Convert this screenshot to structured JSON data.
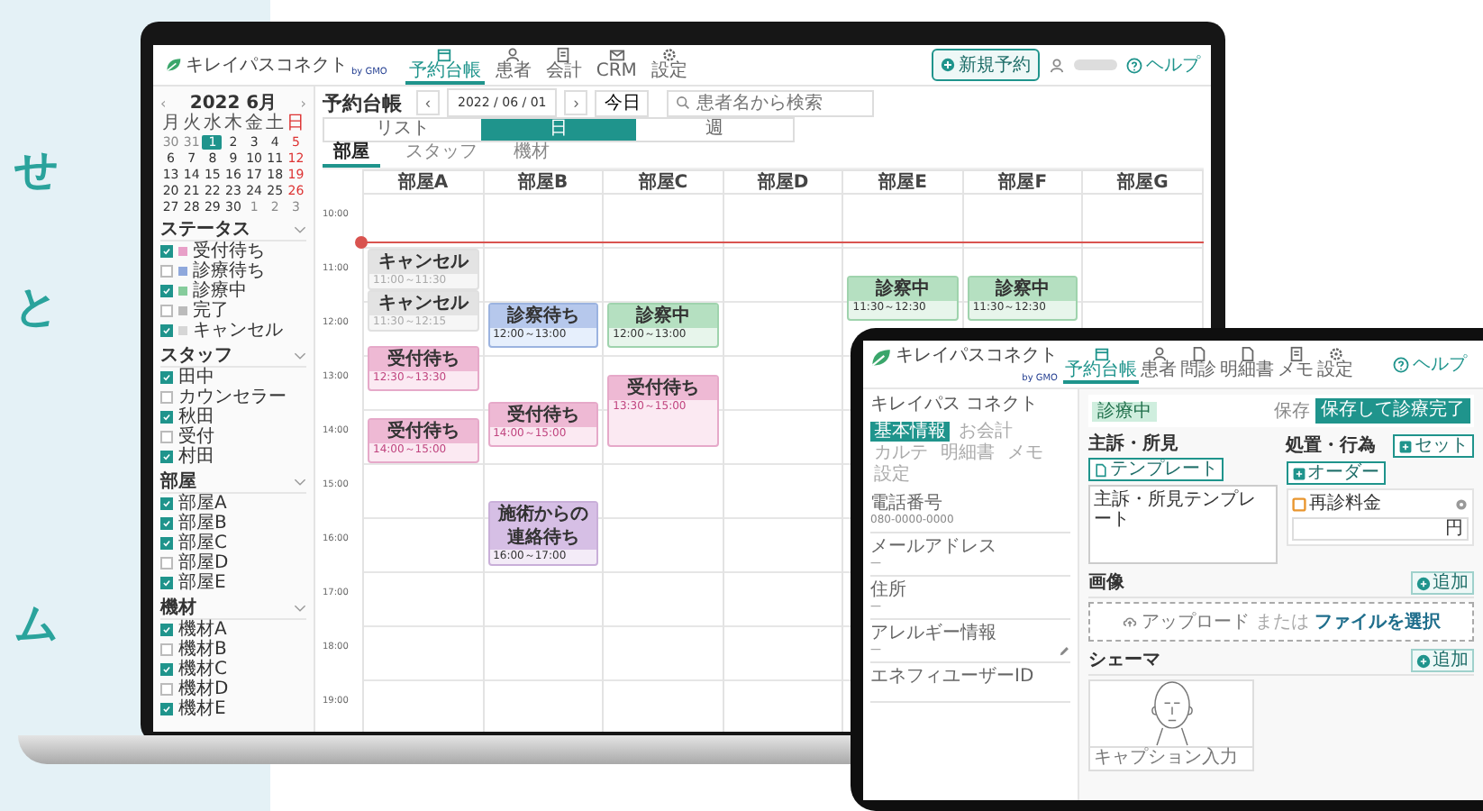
{
  "promo": {
    "chars": [
      "せ",
      "と",
      "ム"
    ]
  },
  "laptop": {
    "logo": {
      "name": "キレイパスコネクト",
      "by": "by GMO"
    },
    "nav": [
      {
        "label": "予約台帳",
        "selected": true
      },
      {
        "label": "患者",
        "selected": false
      },
      {
        "label": "会計",
        "selected": false
      },
      {
        "label": "CRM",
        "selected": false
      },
      {
        "label": "設定",
        "selected": false
      }
    ],
    "new_button": "新規予約",
    "help": "ヘルプ",
    "mini_calendar": {
      "month": "2022 6月",
      "prev": "‹",
      "next": "›",
      "weekdays": [
        "月",
        "火",
        "水",
        "木",
        "金",
        "土",
        "日"
      ],
      "weeks": [
        [
          {
            "day": "30",
            "outside": true,
            "selected": false
          },
          {
            "day": "31",
            "outside": true,
            "selected": false
          },
          {
            "day": "1",
            "outside": false,
            "selected": true
          },
          {
            "day": "2",
            "outside": false,
            "selected": false
          },
          {
            "day": "3",
            "outside": false,
            "selected": false
          },
          {
            "day": "4",
            "outside": false,
            "selected": false
          },
          {
            "day": "5",
            "outside": false,
            "selected": false
          }
        ],
        [
          {
            "day": "6",
            "outside": false,
            "selected": false
          },
          {
            "day": "7",
            "outside": false,
            "selected": false
          },
          {
            "day": "8",
            "outside": false,
            "selected": false
          },
          {
            "day": "9",
            "outside": false,
            "selected": false
          },
          {
            "day": "10",
            "outside": false,
            "selected": false
          },
          {
            "day": "11",
            "outside": false,
            "selected": false
          },
          {
            "day": "12",
            "outside": false,
            "selected": false
          }
        ],
        [
          {
            "day": "13",
            "outside": false,
            "selected": false
          },
          {
            "day": "14",
            "outside": false,
            "selected": false
          },
          {
            "day": "15",
            "outside": false,
            "selected": false
          },
          {
            "day": "16",
            "outside": false,
            "selected": false
          },
          {
            "day": "17",
            "outside": false,
            "selected": false
          },
          {
            "day": "18",
            "outside": false,
            "selected": false
          },
          {
            "day": "19",
            "outside": false,
            "selected": false
          }
        ],
        [
          {
            "day": "20",
            "outside": false,
            "selected": false
          },
          {
            "day": "21",
            "outside": false,
            "selected": false
          },
          {
            "day": "22",
            "outside": false,
            "selected": false
          },
          {
            "day": "23",
            "outside": false,
            "selected": false
          },
          {
            "day": "24",
            "outside": false,
            "selected": false
          },
          {
            "day": "25",
            "outside": false,
            "selected": false
          },
          {
            "day": "26",
            "outside": false,
            "selected": false
          }
        ],
        [
          {
            "day": "27",
            "outside": false,
            "selected": false
          },
          {
            "day": "28",
            "outside": false,
            "selected": false
          },
          {
            "day": "29",
            "outside": false,
            "selected": false
          },
          {
            "day": "30",
            "outside": false,
            "selected": false
          },
          {
            "day": "1",
            "outside": true,
            "selected": false
          },
          {
            "day": "2",
            "outside": true,
            "selected": false
          },
          {
            "day": "3",
            "outside": true,
            "selected": false
          }
        ]
      ]
    },
    "filters": [
      {
        "title": "ステータス",
        "expanded": true,
        "items": [
          {
            "label": "受付待ち",
            "checked": true,
            "color": "#e8a0c8"
          },
          {
            "label": "診療待ち",
            "checked": false,
            "color": "#8fa8dc"
          },
          {
            "label": "診療中",
            "checked": true,
            "color": "#86cc9c"
          },
          {
            "label": "完了",
            "checked": false,
            "color": "#bbbbbb"
          },
          {
            "label": "キャンセル",
            "checked": true,
            "color": "#d6d6d6"
          }
        ]
      },
      {
        "title": "スタッフ",
        "expanded": true,
        "items": [
          {
            "label": "田中",
            "checked": true
          },
          {
            "label": "カウンセラー",
            "checked": false
          },
          {
            "label": "秋田",
            "checked": true
          },
          {
            "label": "受付",
            "checked": false
          },
          {
            "label": "村田",
            "checked": true
          }
        ]
      },
      {
        "title": "部屋",
        "expanded": true,
        "items": [
          {
            "label": "部屋A",
            "checked": true
          },
          {
            "label": "部屋B",
            "checked": true
          },
          {
            "label": "部屋C",
            "checked": true
          },
          {
            "label": "部屋D",
            "checked": false
          },
          {
            "label": "部屋E",
            "checked": true
          }
        ]
      },
      {
        "title": "機材",
        "expanded": true,
        "items": [
          {
            "label": "機材A",
            "checked": true
          },
          {
            "label": "機材B",
            "checked": false
          },
          {
            "label": "機材C",
            "checked": true
          },
          {
            "label": "機材D",
            "checked": false
          },
          {
            "label": "機材E",
            "checked": true
          }
        ]
      }
    ],
    "toolbar": {
      "title": "予約台帳",
      "prev": "‹",
      "date": "2022 / 06 / 01",
      "next": "›",
      "today": "今日",
      "search_placeholder": "患者名から検索"
    },
    "views": [
      {
        "label": "リスト",
        "selected": false
      },
      {
        "label": "日",
        "selected": true
      },
      {
        "label": "週",
        "selected": false
      }
    ],
    "subtabs": [
      {
        "label": "部屋",
        "selected": true
      },
      {
        "label": "スタッフ",
        "selected": false
      },
      {
        "label": "機材",
        "selected": false
      }
    ],
    "times": [
      "10:00",
      "11:00",
      "12:00",
      "13:00",
      "14:00",
      "15:00",
      "16:00",
      "17:00",
      "18:00",
      "19:00"
    ],
    "rooms": [
      {
        "name": "部屋A",
        "events": [
          {
            "kind": "cancel",
            "status": "キャンセル",
            "time": "11:00～11:30"
          },
          {
            "kind": "cancel",
            "status": "キャンセル",
            "time": "11:30～12:15"
          },
          {
            "kind": "waiting",
            "status": "受付待ち",
            "time": "12:30～13:30"
          },
          {
            "kind": "waiting",
            "status": "受付待ち",
            "time": "14:00～15:00"
          }
        ]
      },
      {
        "name": "部屋B",
        "events": [
          {
            "kind": "exam_wait",
            "status": "診察待ち",
            "time": "12:00～13:00"
          },
          {
            "kind": "waiting",
            "status": "受付待ち",
            "time": "14:00～15:00"
          },
          {
            "kind": "contact",
            "status": "施術からの連絡待ち",
            "time": "16:00～17:00"
          }
        ]
      },
      {
        "name": "部屋C",
        "events": [
          {
            "kind": "in_exam",
            "status": "診察中",
            "time": "12:00～13:00"
          },
          {
            "kind": "waiting",
            "status": "受付待ち",
            "time": "13:30～15:00"
          }
        ]
      },
      {
        "name": "部屋D"
      },
      {
        "name": "部屋E",
        "events": [
          {
            "kind": "in_exam",
            "status": "診察中",
            "time": "11:30～12:30"
          }
        ]
      },
      {
        "name": "部屋F",
        "events": [
          {
            "kind": "in_exam",
            "status": "診察中",
            "time": "11:30～12:30"
          }
        ]
      },
      {
        "name": "部屋G"
      }
    ]
  },
  "tablet": {
    "logo": {
      "name": "キレイパスコネクト",
      "by": "by GMO"
    },
    "nav": [
      {
        "label": "予約台帳",
        "selected": true
      },
      {
        "label": "患者",
        "selected": false
      },
      {
        "label": "問診",
        "selected": false
      },
      {
        "label": "明細書",
        "selected": false
      },
      {
        "label": "メモ",
        "selected": false
      },
      {
        "label": "設定",
        "selected": false
      }
    ],
    "help": "ヘルプ",
    "patient": {
      "name": "キレイパス コネクト",
      "tabs": [
        {
          "label": "基本情報",
          "selected": true
        },
        {
          "label": "お会計",
          "selected": false
        },
        {
          "label": "カルテ",
          "selected": false
        },
        {
          "label": "明細書",
          "selected": false
        },
        {
          "label": "メモ",
          "selected": false
        },
        {
          "label": "設定",
          "selected": false
        }
      ],
      "fields": [
        {
          "label": "電話番号",
          "value": "080-0000-0000",
          "editable": false
        },
        {
          "label": "メールアドレス",
          "value": "—",
          "editable": false
        },
        {
          "label": "住所",
          "value": "—",
          "editable": false
        },
        {
          "label": "アレルギー情報",
          "value": "—",
          "editable": true
        },
        {
          "label": "エネフィユーザーID",
          "editable": false
        }
      ]
    },
    "status_badge": "診療中",
    "save": "保存",
    "finish": "保存して診療完了",
    "complaint": {
      "title": "主訴・所見",
      "button": "テンプレート",
      "text": "主訴・所見テンプレート"
    },
    "treatment": {
      "title": "処置・行為",
      "buttons": [
        "セット",
        "オーダー"
      ],
      "item": "再診料金",
      "unit": "円"
    },
    "images": {
      "title": "画像",
      "add": "追加",
      "upload": "アップロード",
      "or": "または",
      "choose": "ファイルを選択"
    },
    "schema": {
      "title": "シェーマ",
      "add": "追加",
      "caption": "キャプション入力"
    }
  }
}
